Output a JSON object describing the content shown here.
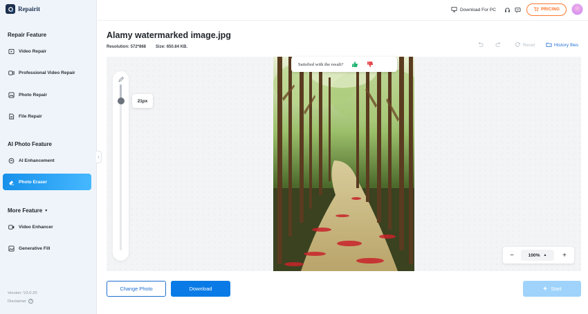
{
  "app": {
    "name": "Repairit",
    "version": "Version: V3.0.20",
    "disclaimer": "Disclaimer"
  },
  "sidebar": {
    "sections": [
      {
        "title": "Repair Feature"
      },
      {
        "title": "AI Photo Feature"
      },
      {
        "title": "More Feature"
      }
    ],
    "items": [
      {
        "label": "Video Repair",
        "icon": "video-repair-icon"
      },
      {
        "label": "Professional Video Repair",
        "icon": "professional-video-icon"
      },
      {
        "label": "Photo Repair",
        "icon": "photo-repair-icon"
      },
      {
        "label": "File Repair",
        "icon": "file-repair-icon"
      },
      {
        "label": "AI Enhancement",
        "icon": "ai-enhance-icon"
      },
      {
        "label": "Photo Eraser",
        "icon": "eraser-icon",
        "active": true
      },
      {
        "label": "Video Enhancer",
        "icon": "video-enhancer-icon"
      },
      {
        "label": "Generative Fill",
        "icon": "generative-fill-icon"
      }
    ]
  },
  "topbar": {
    "download_label": "Download For PC",
    "pricing_label": "PRICING"
  },
  "file": {
    "title": "Alamy watermarked image.jpg",
    "resolution": "Resolution: 572*868",
    "size": "Size: 650.84 KB."
  },
  "toolbar": {
    "reset_label": "Reset",
    "history_label": "History files"
  },
  "brush": {
    "size_label": "21px",
    "level": 0.1
  },
  "feedback": {
    "question": "Satisfied with the result?"
  },
  "zoom": {
    "value": "100%"
  },
  "actions": {
    "change_photo": "Change Photo",
    "download": "Download",
    "start": "Start"
  },
  "colors": {
    "accent": "#0a7be6",
    "pricing": "#ff6a1a",
    "disabled": "#9fd3fb",
    "active_nav": "#1690ea"
  }
}
